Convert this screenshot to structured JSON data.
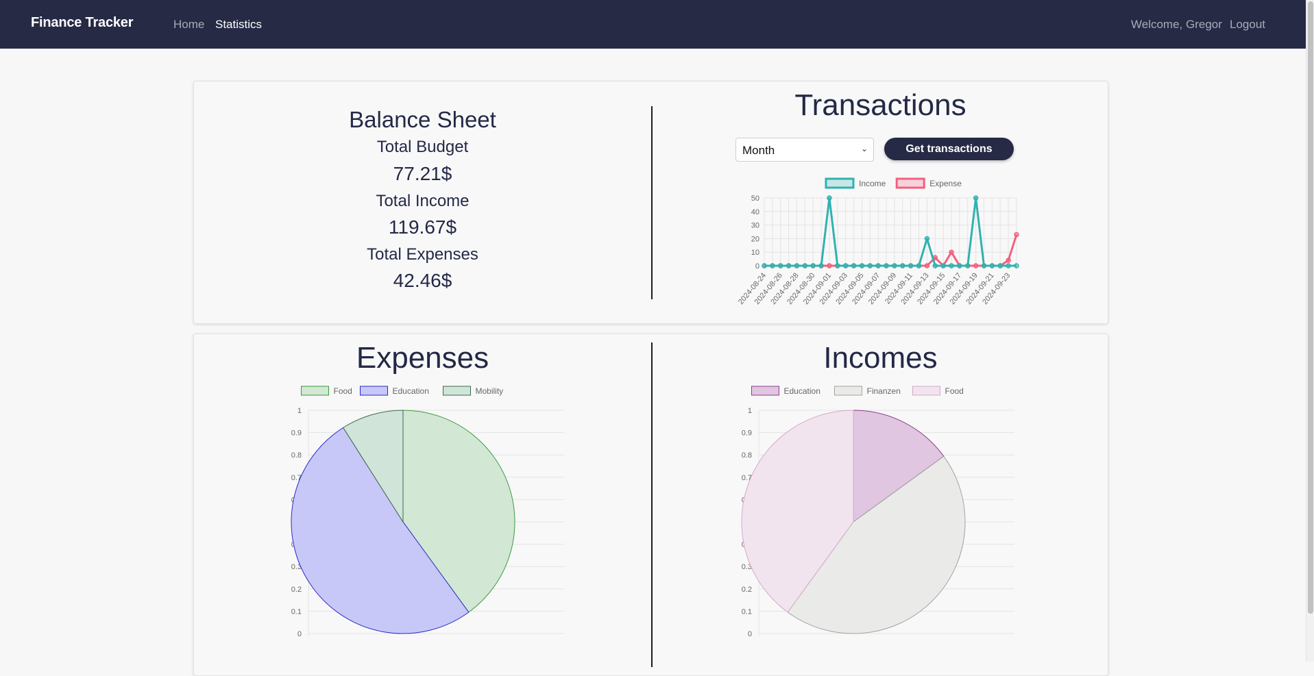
{
  "nav": {
    "brand": "Finance Tracker",
    "home": "Home",
    "statistics": "Statistics",
    "welcome": "Welcome, Gregor",
    "logout": "Logout"
  },
  "balance": {
    "title": "Balance Sheet",
    "budget_label": "Total Budget",
    "budget_value": "77.21$",
    "income_label": "Total Income",
    "income_value": "119.67$",
    "expenses_label": "Total Expenses",
    "expenses_value": "42.46$"
  },
  "transactions": {
    "title": "Transactions",
    "period_select": "Month",
    "button": "Get transactions"
  },
  "expenses": {
    "title": "Expenses"
  },
  "incomes": {
    "title": "Incomes"
  },
  "colors": {
    "nav_bg": "#262a45",
    "income_line": "#2fb2b0",
    "expense_line": "#f2607f"
  },
  "chart_data": [
    {
      "type": "line",
      "x": [
        "2024-08-24",
        "2024-08-25",
        "2024-08-26",
        "2024-08-27",
        "2024-08-28",
        "2024-08-29",
        "2024-08-30",
        "2024-08-31",
        "2024-09-01",
        "2024-09-02",
        "2024-09-03",
        "2024-09-04",
        "2024-09-05",
        "2024-09-06",
        "2024-09-07",
        "2024-09-08",
        "2024-09-09",
        "2024-09-10",
        "2024-09-11",
        "2024-09-12",
        "2024-09-13",
        "2024-09-14",
        "2024-09-15",
        "2024-09-16",
        "2024-09-17",
        "2024-09-18",
        "2024-09-19",
        "2024-09-20",
        "2024-09-21",
        "2024-09-22",
        "2024-09-23",
        "2024-09-24"
      ],
      "tick_labels": [
        "2024-08-24",
        "2024-08-26",
        "2024-08-28",
        "2024-08-30",
        "2024-09-01",
        "2024-09-03",
        "2024-09-05",
        "2024-09-07",
        "2024-09-09",
        "2024-09-11",
        "2024-09-13",
        "2024-09-15",
        "2024-09-17",
        "2024-09-19",
        "2024-09-21",
        "2024-09-23"
      ],
      "series": [
        {
          "name": "Income",
          "color": "#2fb2b0",
          "values": [
            0,
            0,
            0,
            0,
            0,
            0,
            0,
            0,
            50,
            0,
            0,
            0,
            0,
            0,
            0,
            0,
            0,
            0,
            0,
            0,
            20,
            0,
            0,
            0,
            0,
            0,
            50,
            0,
            0,
            0,
            0,
            0
          ]
        },
        {
          "name": "Expense",
          "color": "#f2607f",
          "values": [
            0,
            0,
            0,
            0,
            0,
            0,
            0,
            0,
            0,
            0,
            0,
            0,
            0,
            0,
            0,
            0,
            0,
            0,
            0,
            0,
            0,
            6,
            0,
            10,
            0,
            0,
            0,
            0,
            0,
            0,
            4,
            23
          ]
        }
      ],
      "ylim": [
        0,
        50
      ],
      "yticks": [
        0,
        10,
        20,
        30,
        40,
        50
      ],
      "legend": "top",
      "grid": true
    },
    {
      "type": "pie",
      "categories": [
        "Food",
        "Education",
        "Mobility"
      ],
      "values": [
        0.4,
        0.51,
        0.09
      ],
      "colors": [
        [
          "#d2e7d4",
          "#3a9a41"
        ],
        [
          "#c8c8f8",
          "#2929c9"
        ],
        [
          "#d1e4d9",
          "#3c6b4c"
        ]
      ],
      "yticks": [
        "0",
        "0.1",
        "0.2",
        "0.3",
        "0.4",
        "0.5",
        "0.6",
        "0.7",
        "0.8",
        "0.9",
        "1"
      ],
      "legend": "top",
      "grid": true
    },
    {
      "type": "pie",
      "categories": [
        "Education",
        "Finanzen",
        "Food"
      ],
      "values": [
        0.15,
        0.45,
        0.4
      ],
      "colors": [
        [
          "#e0c6e0",
          "#8b3e8b"
        ],
        [
          "#eaeae8",
          "#a3a3a0"
        ],
        [
          "#f1e4ee",
          "#d6a7ca"
        ]
      ],
      "yticks": [
        "0",
        "0.1",
        "0.2",
        "0.3",
        "0.4",
        "0.5",
        "0.6",
        "0.7",
        "0.8",
        "0.9",
        "1"
      ],
      "legend": "top",
      "grid": true
    }
  ]
}
